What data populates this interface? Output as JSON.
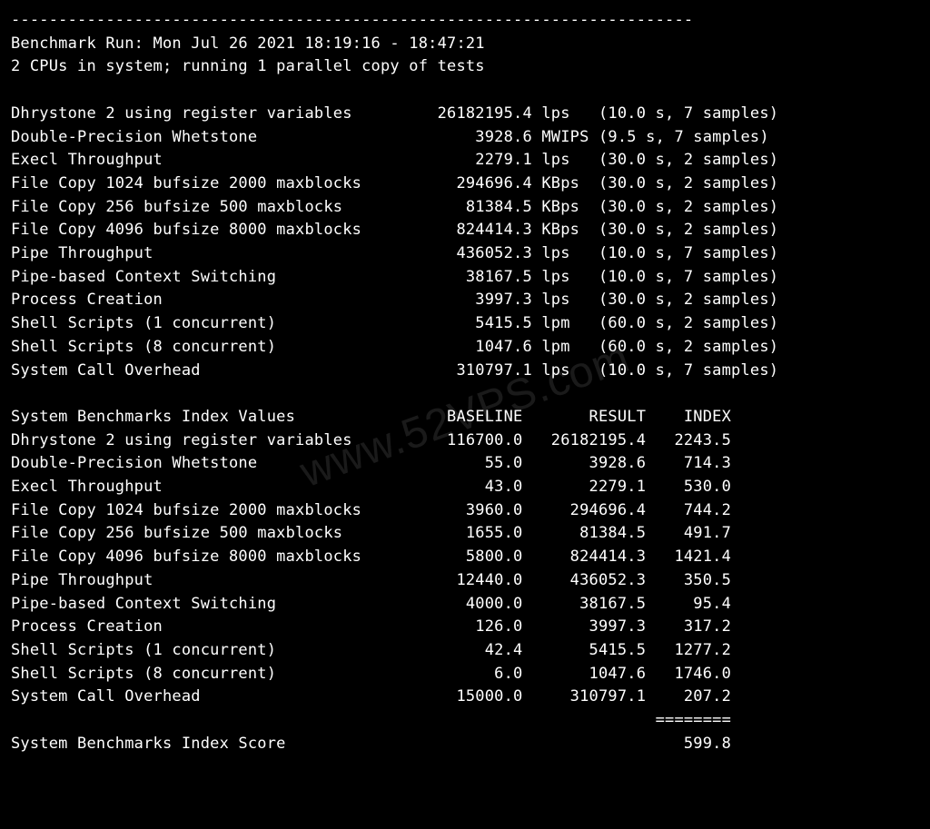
{
  "watermark": "www.52VPS.com",
  "header": {
    "separator": "------------------------------------------------------------------------",
    "run_line": "Benchmark Run: Mon Jul 26 2021 18:19:16 - 18:47:21",
    "cpu_line": "2 CPUs in system; running 1 parallel copy of tests"
  },
  "raw_results": [
    {
      "name": "Dhrystone 2 using register variables",
      "value": "26182195.4",
      "unit": "lps",
      "timing": "(10.0 s, 7 samples)"
    },
    {
      "name": "Double-Precision Whetstone",
      "value": "3928.6",
      "unit": "MWIPS",
      "timing": "(9.5 s, 7 samples)"
    },
    {
      "name": "Execl Throughput",
      "value": "2279.1",
      "unit": "lps",
      "timing": "(30.0 s, 2 samples)"
    },
    {
      "name": "File Copy 1024 bufsize 2000 maxblocks",
      "value": "294696.4",
      "unit": "KBps",
      "timing": "(30.0 s, 2 samples)"
    },
    {
      "name": "File Copy 256 bufsize 500 maxblocks",
      "value": "81384.5",
      "unit": "KBps",
      "timing": "(30.0 s, 2 samples)"
    },
    {
      "name": "File Copy 4096 bufsize 8000 maxblocks",
      "value": "824414.3",
      "unit": "KBps",
      "timing": "(30.0 s, 2 samples)"
    },
    {
      "name": "Pipe Throughput",
      "value": "436052.3",
      "unit": "lps",
      "timing": "(10.0 s, 7 samples)"
    },
    {
      "name": "Pipe-based Context Switching",
      "value": "38167.5",
      "unit": "lps",
      "timing": "(10.0 s, 7 samples)"
    },
    {
      "name": "Process Creation",
      "value": "3997.3",
      "unit": "lps",
      "timing": "(30.0 s, 2 samples)"
    },
    {
      "name": "Shell Scripts (1 concurrent)",
      "value": "5415.5",
      "unit": "lpm",
      "timing": "(60.0 s, 2 samples)"
    },
    {
      "name": "Shell Scripts (8 concurrent)",
      "value": "1047.6",
      "unit": "lpm",
      "timing": "(60.0 s, 2 samples)"
    },
    {
      "name": "System Call Overhead",
      "value": "310797.1",
      "unit": "lps",
      "timing": "(10.0 s, 7 samples)"
    }
  ],
  "index_header": {
    "title": "System Benchmarks Index Values",
    "cols": [
      "BASELINE",
      "RESULT",
      "INDEX"
    ]
  },
  "index_results": [
    {
      "name": "Dhrystone 2 using register variables",
      "baseline": "116700.0",
      "result": "26182195.4",
      "index": "2243.5"
    },
    {
      "name": "Double-Precision Whetstone",
      "baseline": "55.0",
      "result": "3928.6",
      "index": "714.3"
    },
    {
      "name": "Execl Throughput",
      "baseline": "43.0",
      "result": "2279.1",
      "index": "530.0"
    },
    {
      "name": "File Copy 1024 bufsize 2000 maxblocks",
      "baseline": "3960.0",
      "result": "294696.4",
      "index": "744.2"
    },
    {
      "name": "File Copy 256 bufsize 500 maxblocks",
      "baseline": "1655.0",
      "result": "81384.5",
      "index": "491.7"
    },
    {
      "name": "File Copy 4096 bufsize 8000 maxblocks",
      "baseline": "5800.0",
      "result": "824414.3",
      "index": "1421.4"
    },
    {
      "name": "Pipe Throughput",
      "baseline": "12440.0",
      "result": "436052.3",
      "index": "350.5"
    },
    {
      "name": "Pipe-based Context Switching",
      "baseline": "4000.0",
      "result": "38167.5",
      "index": "95.4"
    },
    {
      "name": "Process Creation",
      "baseline": "126.0",
      "result": "3997.3",
      "index": "317.2"
    },
    {
      "name": "Shell Scripts (1 concurrent)",
      "baseline": "42.4",
      "result": "5415.5",
      "index": "1277.2"
    },
    {
      "name": "Shell Scripts (8 concurrent)",
      "baseline": "6.0",
      "result": "1047.6",
      "index": "1746.0"
    },
    {
      "name": "System Call Overhead",
      "baseline": "15000.0",
      "result": "310797.1",
      "index": "207.2"
    }
  ],
  "score": {
    "rule": "========",
    "label": "System Benchmarks Index Score",
    "value": "599.8"
  }
}
